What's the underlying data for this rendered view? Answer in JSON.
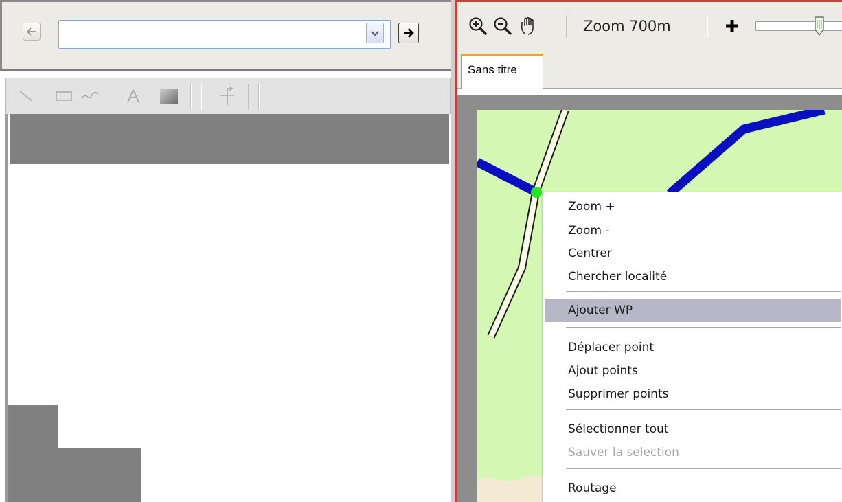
{
  "colors": {
    "map_background": "#d4f7b3",
    "route_blue": "#0a0fc3",
    "waypoint_green": "#1fe61f",
    "panel_red_border": "#d33a32",
    "menu_highlight": "#b7b7c7"
  },
  "left": {
    "address_value": "",
    "tools": [
      "line-icon",
      "rectangle-icon",
      "curve-icon",
      "text-icon",
      "fill-icon",
      "route-icon"
    ]
  },
  "map_toolbar": {
    "zoom_label": "Zoom 700m",
    "icons": [
      "zoom-in-icon",
      "zoom-out-icon",
      "pan-hand-icon",
      "plus-icon"
    ]
  },
  "tabs": [
    {
      "label": "Sans titre",
      "active": true
    }
  ],
  "context_menu": {
    "items": [
      {
        "label": "Zoom +",
        "enabled": true,
        "highlighted": false
      },
      {
        "label": "Zoom -",
        "enabled": true,
        "highlighted": false
      },
      {
        "label": "Centrer",
        "enabled": true,
        "highlighted": false
      },
      {
        "label": "Chercher localité",
        "enabled": true,
        "highlighted": false
      },
      {
        "label": "Ajouter WP",
        "enabled": true,
        "highlighted": true
      },
      {
        "label": "Déplacer point",
        "enabled": true,
        "highlighted": false
      },
      {
        "label": "Ajout points",
        "enabled": true,
        "highlighted": false
      },
      {
        "label": "Supprimer points",
        "enabled": true,
        "highlighted": false
      },
      {
        "label": "Sélectionner tout",
        "enabled": true,
        "highlighted": false
      },
      {
        "label": "Sauver la selection",
        "enabled": false,
        "highlighted": false
      },
      {
        "label": "Routage",
        "enabled": true,
        "highlighted": false
      }
    ]
  }
}
